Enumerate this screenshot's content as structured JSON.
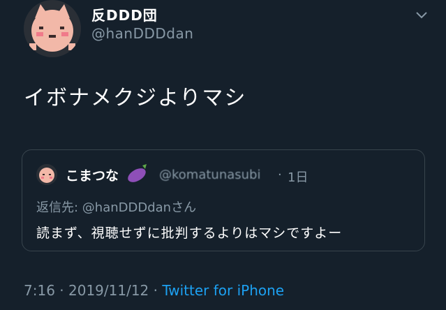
{
  "author": {
    "display_name": "反DDD団",
    "handle": "@hanDDDdan",
    "avatar_icon": "cat-avatar-icon"
  },
  "tweet": {
    "text": "イボナメクジよりマシ"
  },
  "quoted_tweet": {
    "display_name": "こまつな",
    "emoji_icon": "eggplant-icon",
    "handle": "@komatunasubi",
    "separator": "·",
    "time": "1日",
    "reply_to": "返信先: @hanDDDdanさん",
    "text": "読まず、視聴せずに批判するよりはマシですよー"
  },
  "meta": {
    "time": "7:16",
    "separator": "·",
    "date": "2019/11/12",
    "source": "Twitter for iPhone"
  },
  "colors": {
    "background": "#15202b",
    "secondary_text": "#8899a6",
    "link": "#1da1f2",
    "border": "#38444d"
  }
}
